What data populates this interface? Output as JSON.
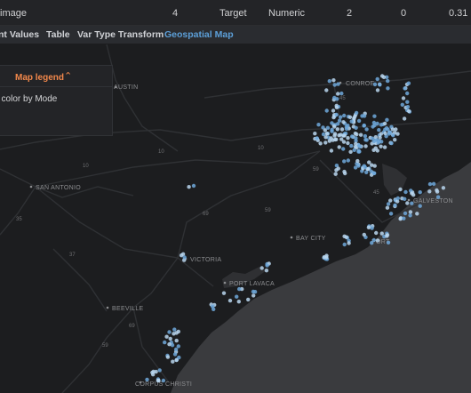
{
  "table_row": {
    "feature_name": "image",
    "count": "4",
    "role": "Target",
    "type": "Numeric",
    "value_a": "2",
    "value_b": "0",
    "value_c": "0.31"
  },
  "tabs": [
    {
      "label": "nt Values",
      "active": false
    },
    {
      "label": "Table",
      "active": false
    },
    {
      "label": "Var Type Transform",
      "active": false
    },
    {
      "label": "Geospatial Map",
      "active": true
    }
  ],
  "legend": {
    "title": "Map legend",
    "text": "t color by Mode",
    "accent_color": "#f2884b"
  },
  "map": {
    "point_color": "#6ea8da",
    "cities": [
      {
        "name": "AUSTIN"
      },
      {
        "name": "SAN ANTONIO"
      },
      {
        "name": "CONROE"
      },
      {
        "name": "VICTORIA"
      },
      {
        "name": "BAY CITY"
      },
      {
        "name": "PORT LAVACA"
      },
      {
        "name": "BEEVILLE"
      },
      {
        "name": "CORPUS CHRISTI"
      },
      {
        "name": "GALVESTON"
      },
      {
        "name": "PORT"
      }
    ],
    "road_numbers": [
      "10",
      "10",
      "35",
      "69",
      "59",
      "37",
      "10",
      "69",
      "59",
      "45",
      "45",
      "59"
    ]
  }
}
